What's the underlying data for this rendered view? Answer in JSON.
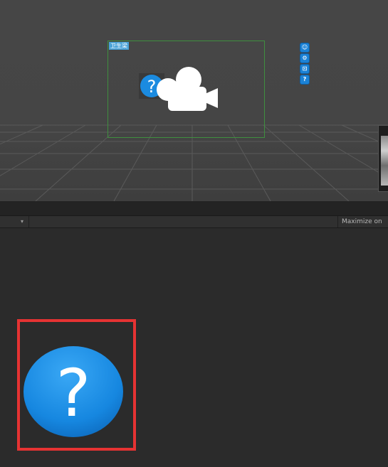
{
  "scene_view": {
    "object_label": "卫生梁",
    "help_icon_symbol": "?",
    "side_icons": [
      "person-icon",
      "settings-icon",
      "lock-icon",
      "question-icon"
    ],
    "side_icon_glyphs": [
      "☺",
      "⚙",
      "⊡",
      "?"
    ]
  },
  "game_toolbar": {
    "aspect_dropdown_arrow": "▾",
    "maximize_label": "Maximize on"
  },
  "game_view": {
    "help_icon_symbol": "?"
  },
  "colors": {
    "help_blue": "#1b8be0",
    "highlight_red": "#e63333",
    "selection_green": "#3f8f3f",
    "label_blue": "#4aa3d8"
  }
}
